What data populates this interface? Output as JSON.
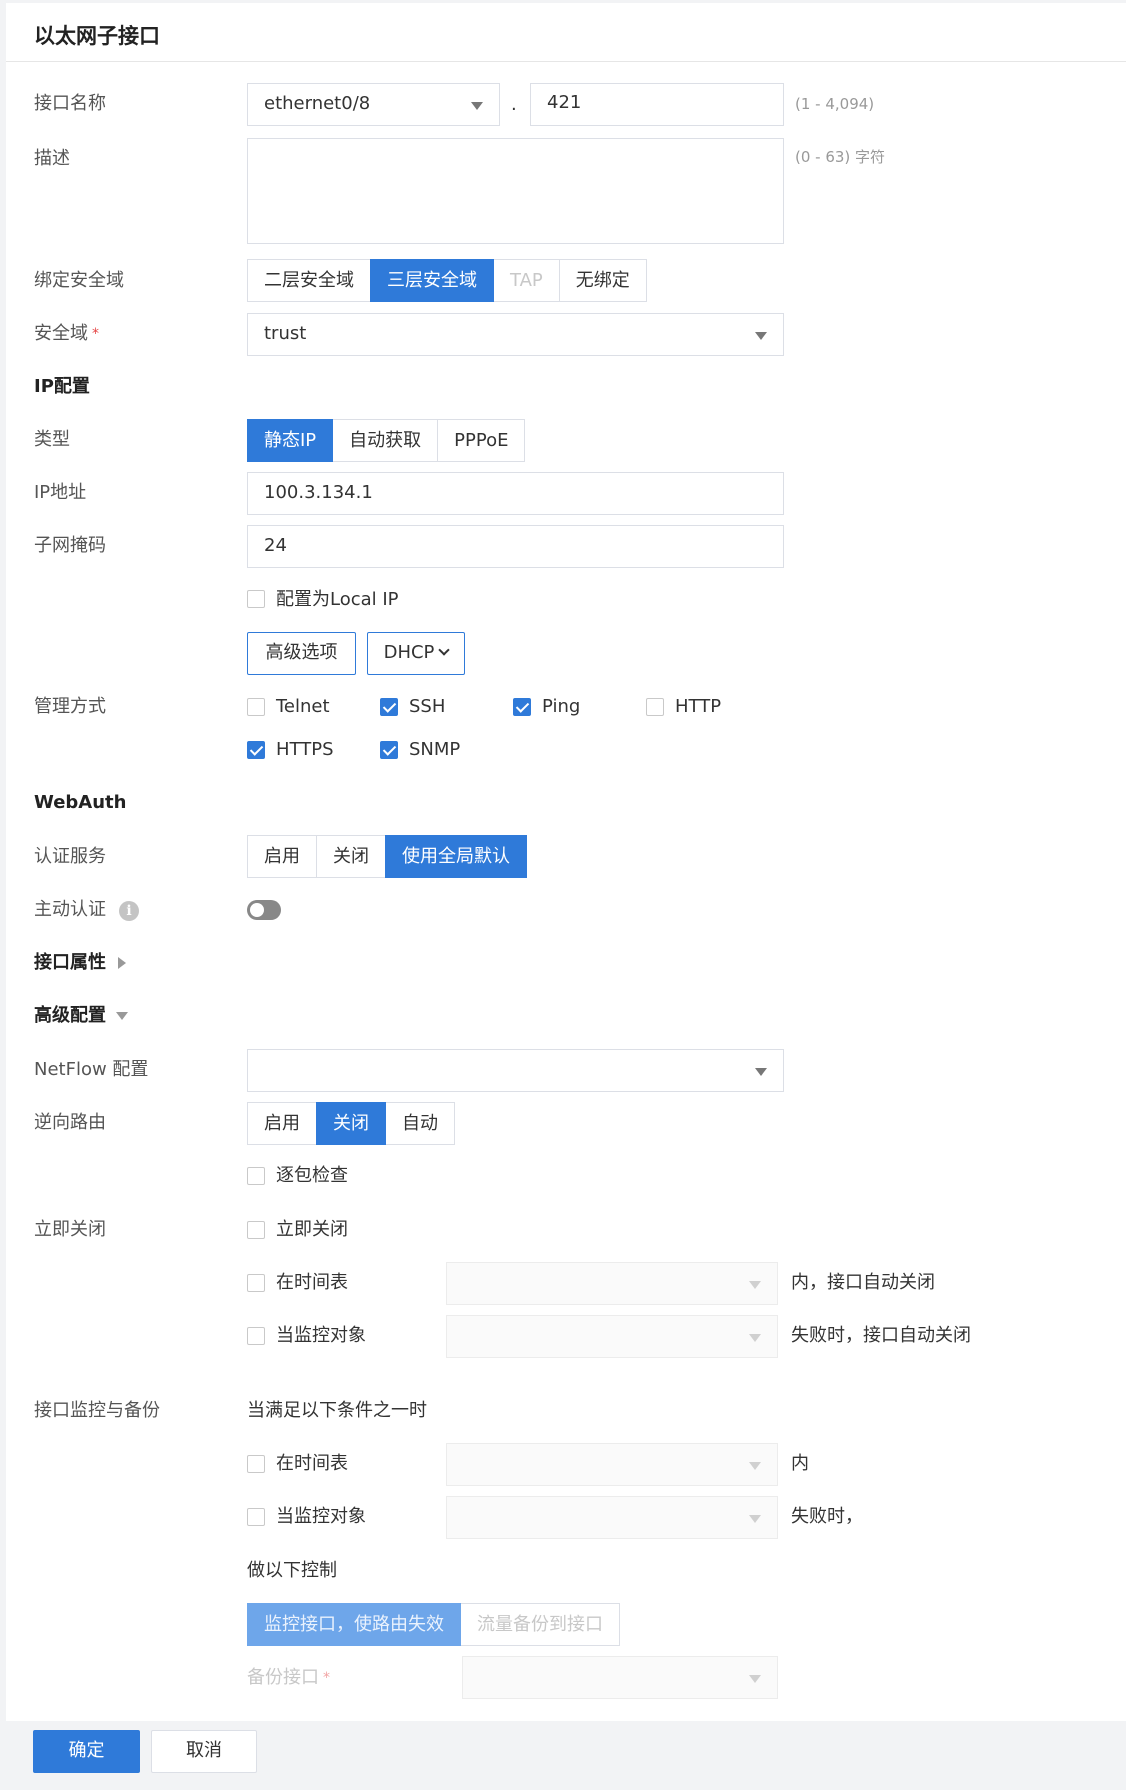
{
  "header": {
    "title": "以太网子接口"
  },
  "interface_name": {
    "label": "接口名称",
    "interface_value": "ethernet0/8",
    "separator": ".",
    "subid_value": "421",
    "hint": "(1 - 4,094)"
  },
  "description": {
    "label": "描述",
    "value": "",
    "hint": "(0 - 63) 字符"
  },
  "bind_zone": {
    "label": "绑定安全域",
    "options": [
      "二层安全域",
      "三层安全域",
      "TAP",
      "无绑定"
    ],
    "selected": "三层安全域"
  },
  "zone": {
    "label": "安全域",
    "required_mark": "*",
    "value": "trust"
  },
  "ip_config": {
    "section_title": "IP配置",
    "type_label": "类型",
    "type_options": [
      "静态IP",
      "自动获取",
      "PPPoE"
    ],
    "type_selected": "静态IP",
    "ip_label": "IP地址",
    "ip_value": "100.3.134.1",
    "mask_label": "子网掩码",
    "mask_value": "24",
    "local_ip_label": "配置为Local IP",
    "local_ip_checked": false,
    "advanced_button": "高级选项",
    "dhcp_button": "DHCP"
  },
  "management": {
    "label": "管理方式",
    "items": [
      {
        "label": "Telnet",
        "checked": false
      },
      {
        "label": "SSH",
        "checked": true
      },
      {
        "label": "Ping",
        "checked": true
      },
      {
        "label": "HTTP",
        "checked": false
      },
      {
        "label": "HTTPS",
        "checked": true
      },
      {
        "label": "SNMP",
        "checked": true
      }
    ]
  },
  "webauth": {
    "section_title": "WebAuth",
    "auth_label": "认证服务",
    "auth_options": [
      "启用",
      "关闭",
      "使用全局默认"
    ],
    "auth_selected": "使用全局默认",
    "active_auth_label": "主动认证",
    "active_auth_on": false
  },
  "interface_props": {
    "section_title": "接口属性",
    "expanded": false
  },
  "advanced": {
    "section_title": "高级配置",
    "expanded": true,
    "netflow_label": "NetFlow 配置",
    "netflow_value": "",
    "reverse_route_label": "逆向路由",
    "reverse_route_options": [
      "启用",
      "关闭",
      "自动"
    ],
    "reverse_route_selected": "关闭",
    "packet_check_label": "逐包检查",
    "packet_check_checked": false
  },
  "shutdown": {
    "label": "立即关闭",
    "immediate_label": "立即关闭",
    "schedule_label": "在时间表",
    "schedule_suffix": "内，接口自动关闭",
    "monitor_label": "当监控对象",
    "monitor_suffix": "失败时，接口自动关闭"
  },
  "monitor_backup": {
    "label": "接口监控与备份",
    "condition_text": "当满足以下条件之一时",
    "schedule_label": "在时间表",
    "schedule_suffix": "内",
    "monitor_label": "当监控对象",
    "monitor_suffix": "失败时，",
    "action_text": "做以下控制",
    "action_options": [
      "监控接口，使路由失效",
      "流量备份到接口"
    ],
    "action_selected": "监控接口，使路由失效",
    "backup_label": "备份接口",
    "backup_required_mark": "*"
  },
  "footer": {
    "ok_label": "确定",
    "cancel_label": "取消"
  },
  "colors": {
    "accent": "#2f7ad9",
    "required": "#e54545"
  }
}
